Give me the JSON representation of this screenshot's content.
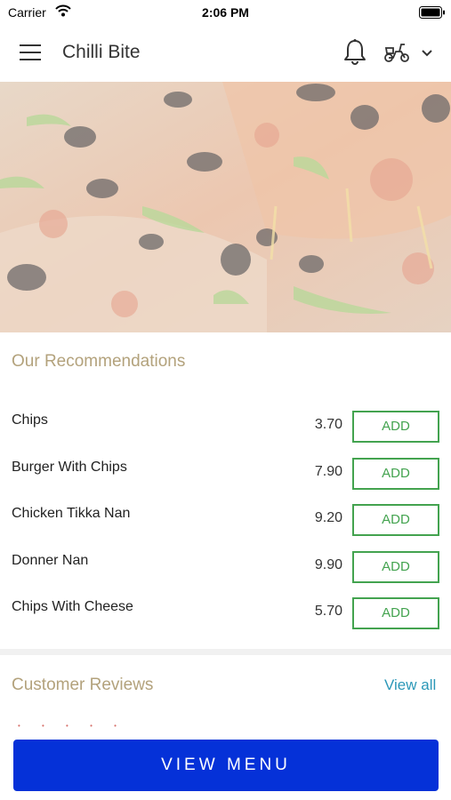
{
  "status_bar": {
    "carrier": "Carrier",
    "time": "2:06 PM"
  },
  "header": {
    "title": "Chilli Bite"
  },
  "recommendations": {
    "title": "Our Recommendations",
    "items": [
      {
        "name": "Chips",
        "price": "3.70",
        "add_label": "ADD"
      },
      {
        "name": "Burger With Chips",
        "price": "7.90",
        "add_label": "ADD"
      },
      {
        "name": "Chicken Tikka Nan",
        "price": "9.20",
        "add_label": "ADD"
      },
      {
        "name": "Donner Nan",
        "price": "9.90",
        "add_label": "ADD"
      },
      {
        "name": "Chips With Cheese",
        "price": "5.70",
        "add_label": "ADD"
      }
    ]
  },
  "reviews": {
    "title": "Customer Reviews",
    "view_all": "View all",
    "stars": "• • • • •"
  },
  "footer": {
    "view_menu_label": "VIEW MENU"
  },
  "colors": {
    "accent_green": "#43a34f",
    "primary_blue": "#0531d8",
    "link_teal": "#2c98b8",
    "section_title": "#b3a27c"
  },
  "icons": [
    "menu-icon",
    "bell-icon",
    "scooter-icon",
    "chevron-down-icon",
    "wifi-icon",
    "battery-icon"
  ]
}
